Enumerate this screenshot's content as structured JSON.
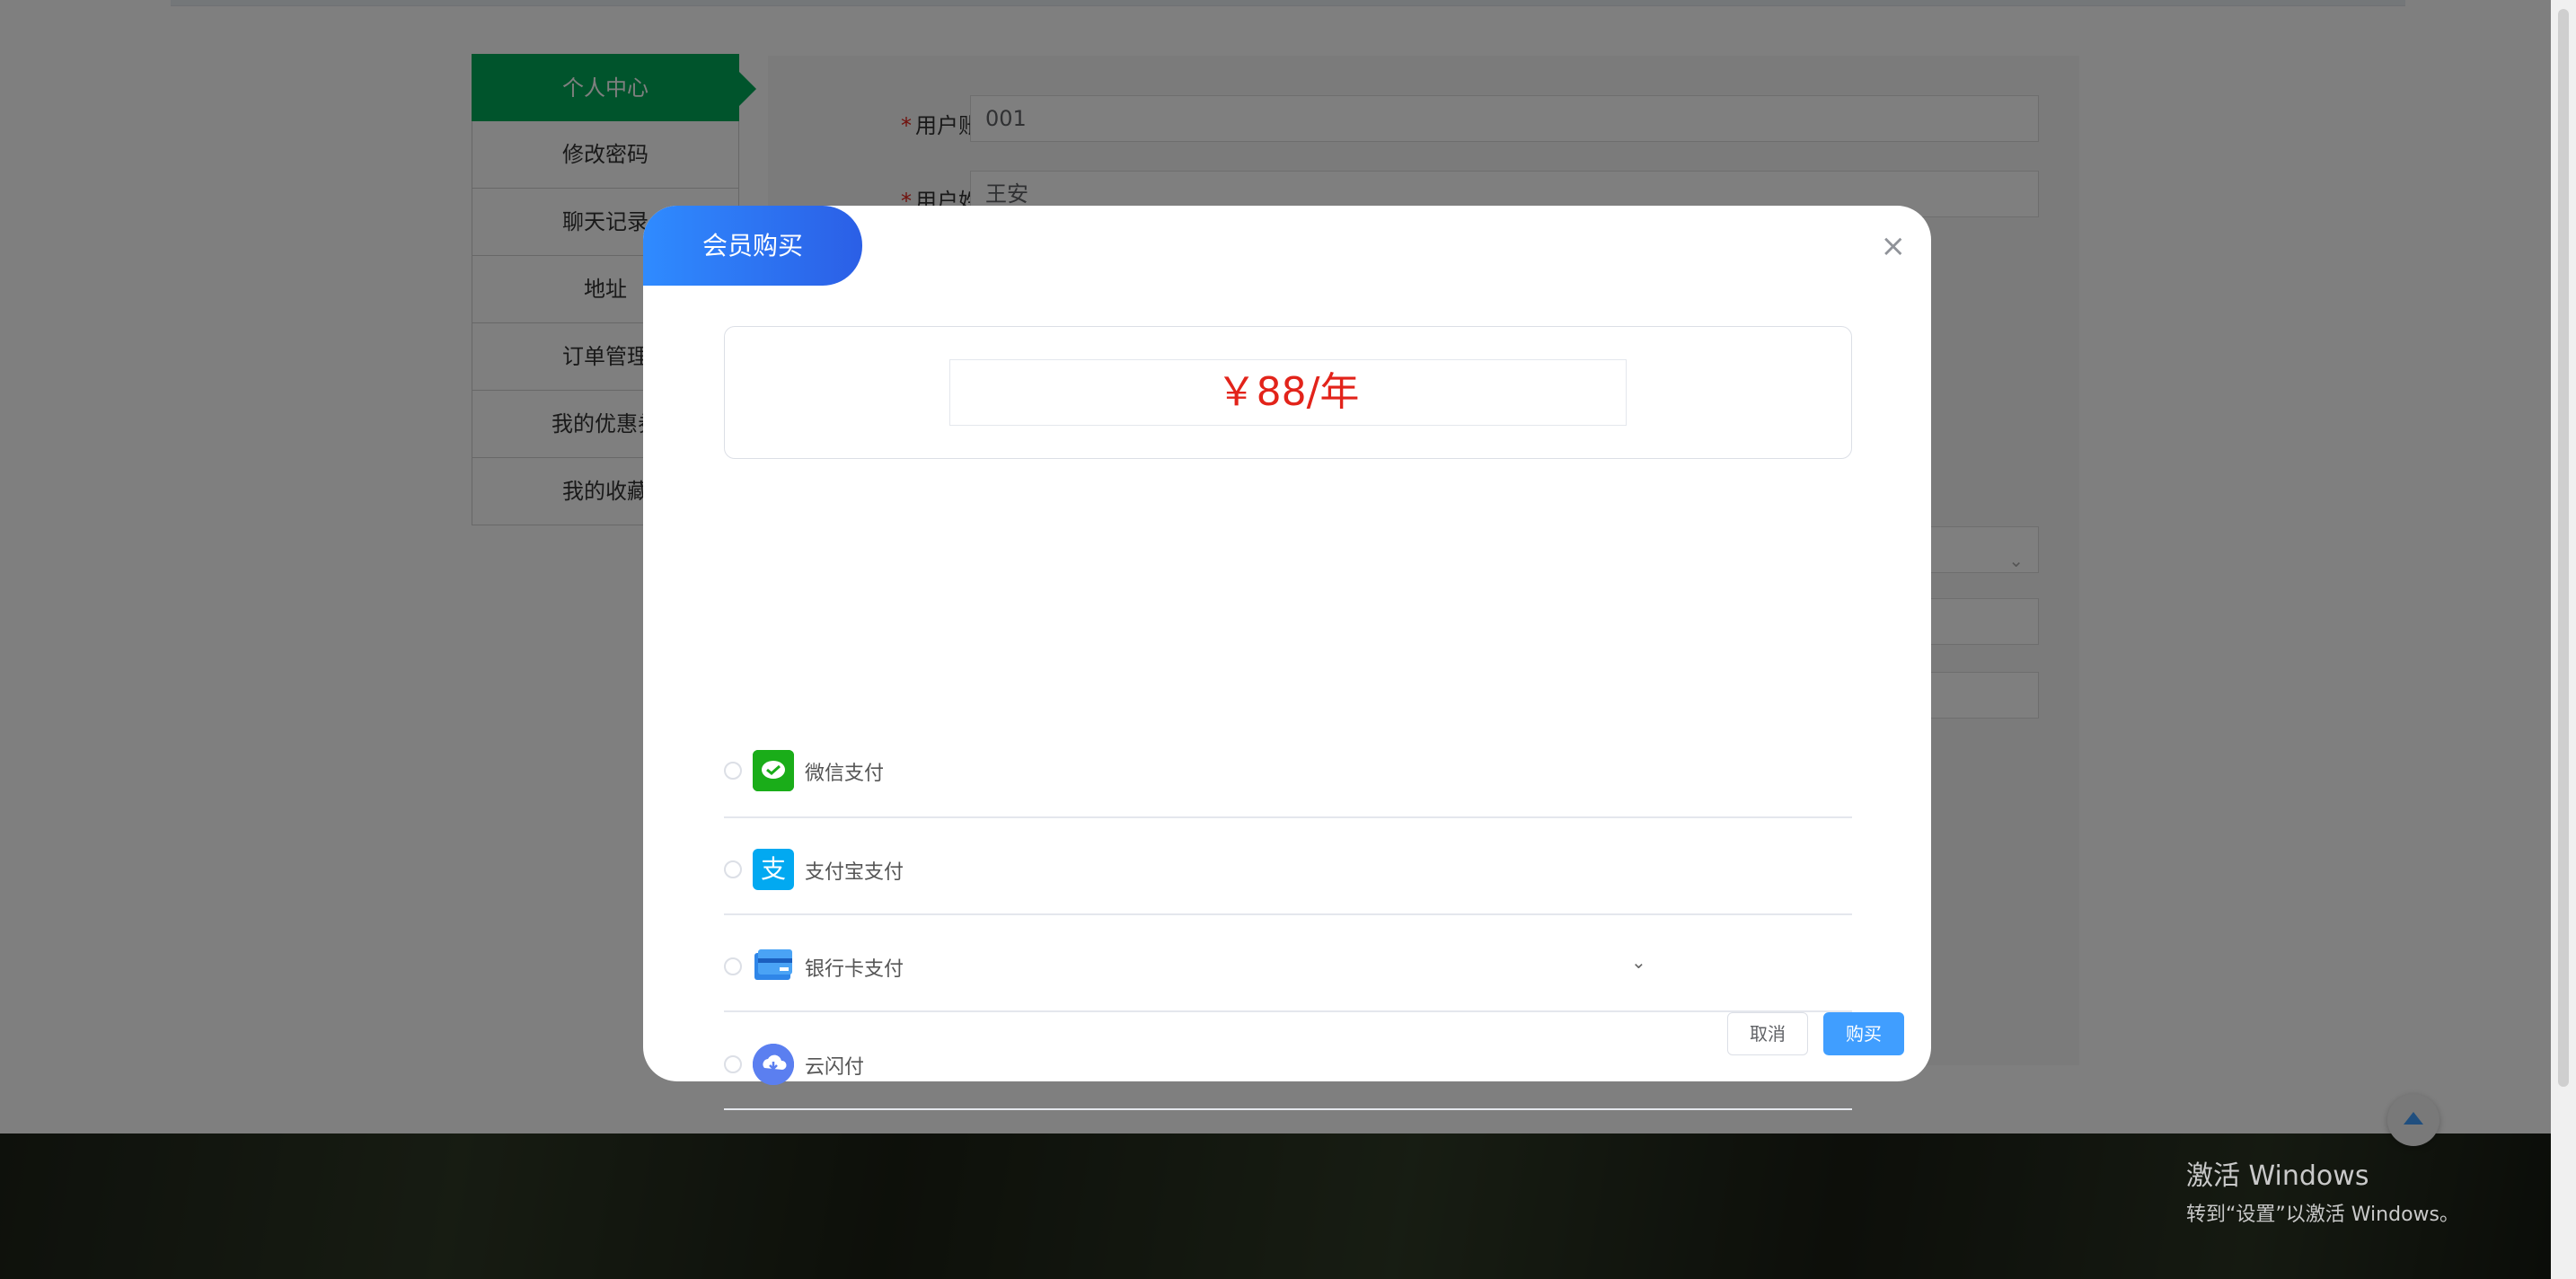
{
  "sidebar": {
    "items": [
      {
        "label": "个人中心",
        "active": true
      },
      {
        "label": "修改密码"
      },
      {
        "label": "聊天记录"
      },
      {
        "label": "地址"
      },
      {
        "label": "订单管理"
      },
      {
        "label": "我的优惠券"
      },
      {
        "label": "我的收藏"
      }
    ]
  },
  "form": {
    "account_label": "用户账号",
    "account_value": "001",
    "name_label": "用户姓名",
    "name_value": "王安"
  },
  "dialog": {
    "title": "会员购买",
    "price": "￥88/年",
    "payments": [
      {
        "label": "微信支付",
        "icon": "wechat-pay-icon"
      },
      {
        "label": "支付宝支付",
        "icon": "alipay-icon"
      },
      {
        "label": "银行卡支付",
        "icon": "bank-card-icon"
      },
      {
        "label": "云闪付",
        "icon": "cloud-quickpass-icon"
      }
    ],
    "cancel_label": "取消",
    "buy_label": "购买"
  },
  "watermark": {
    "line1": "激活 Windows",
    "line2": "转到“设置”以激活 Windows。"
  },
  "colors": {
    "sidebar_active": "#00a859",
    "dialog_title": "#2f8bff",
    "price": "#e2231a",
    "primary_button": "#409eff"
  }
}
